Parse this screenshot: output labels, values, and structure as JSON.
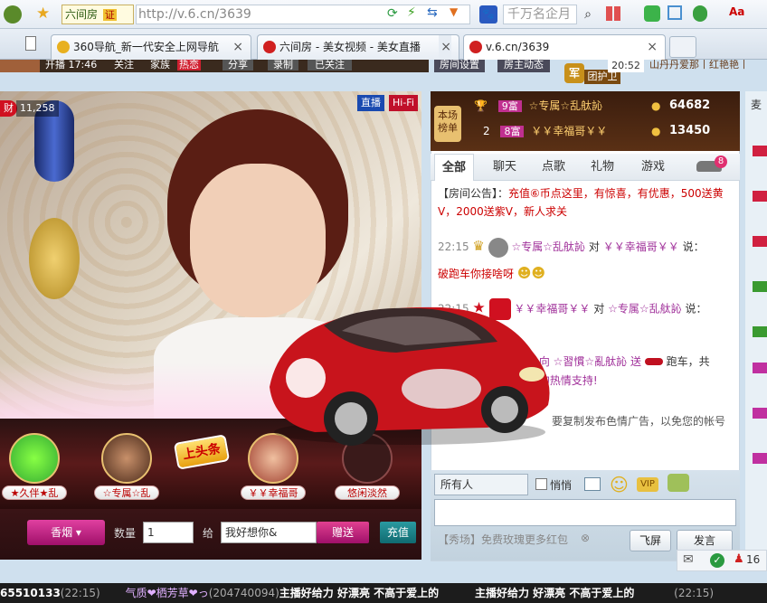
{
  "browser": {
    "site_badge": "六间房",
    "cert_badge": "证",
    "url": "http://v.6.cn/3639",
    "search_placeholder": "千万名企月",
    "font_label": "Aa"
  },
  "tabs": [
    {
      "label": "360导航_新一代安全上网导航",
      "close": "×"
    },
    {
      "label": "六间房 - 美女视频 - 美女直播",
      "close": "×"
    },
    {
      "label": "v.6.cn/3639",
      "close": "×"
    }
  ],
  "topstrip": {
    "host_info": "开播 17:46",
    "follow": "关注",
    "family": "家族",
    "family_badge": "热恋",
    "share": "分享",
    "record": "录制",
    "followed": "已关注",
    "room_settings": "房间设置",
    "room_events": "房主动态",
    "time": "20:52",
    "marquee": "山丹丹爱那丨红艳艳丨"
  },
  "video": {
    "wealth_label": "财",
    "wealth_count": "11,258",
    "live_badge": "直播",
    "hifi_badge": "Hi-Fi"
  },
  "guard": {
    "badge": "军",
    "label": "团护卫"
  },
  "rank": {
    "title": "本场榜单",
    "entries": [
      {
        "rank": "1",
        "level": "9富",
        "name": "☆专属☆乱舦訫",
        "score": "64682"
      },
      {
        "rank": "2",
        "level": "8富",
        "name": "￥￥幸福哥￥￥",
        "score": "13450"
      }
    ]
  },
  "chat_tabs": [
    "全部",
    "聊天",
    "点歌",
    "礼物",
    "游戏"
  ],
  "chat_tab_badge": "8",
  "announcement": {
    "prefix": "【房间公告】：",
    "text": "充值⑥币点这里，有惊喜，有优惠，500送黄V，2000送紫V，新人求关"
  },
  "messages": [
    {
      "time": "22:15",
      "from": "☆专属☆乱舦訫",
      "to_word": "对",
      "to": "￥￥幸福哥￥￥",
      "say": "说：",
      "text": "破跑车你接啥呀"
    },
    {
      "time": "22:15",
      "from": "￥￥幸福哥￥￥",
      "to_word": "对",
      "to": "☆专属☆乱舦訫",
      "say": "说："
    }
  ],
  "gift_msg": {
    "part1": "訫 向 ☆習慣☆亂舦訫 送",
    "gift": "跑车，共",
    "part2": "訫 的热情支持!"
  },
  "warning": "要复制发布色情广告，以免您的帐号",
  "stage_seats": [
    "★久伴★乱",
    "☆专属☆乱",
    "￥￥幸福哥",
    "悠闲淡然"
  ],
  "headline": "上头条",
  "giftbar": {
    "gift_name": "香烟",
    "qty_label": "数量",
    "qty_value": "1",
    "to_label": "给",
    "to_value": "我好想你&",
    "send": "赠送",
    "recharge": "充值"
  },
  "chat_input": {
    "recipient": "所有人",
    "private": "悄悄",
    "vip": "VIP",
    "fly": "飞屏",
    "send": "发言",
    "hint": "【秀场】免费玫瑰更多红包"
  },
  "right_count": "16",
  "right_label": "麦",
  "footer": {
    "id": "65510133",
    "time1": "(22:15)",
    "user": "气质❤栖芳草❤っ",
    "uid": "(204740094)",
    "text": "主播好给力 好漂亮 不高于爱上的",
    "text2": "主播好给力 好漂亮 不高于爱上的",
    "time2": "(22:15)"
  }
}
